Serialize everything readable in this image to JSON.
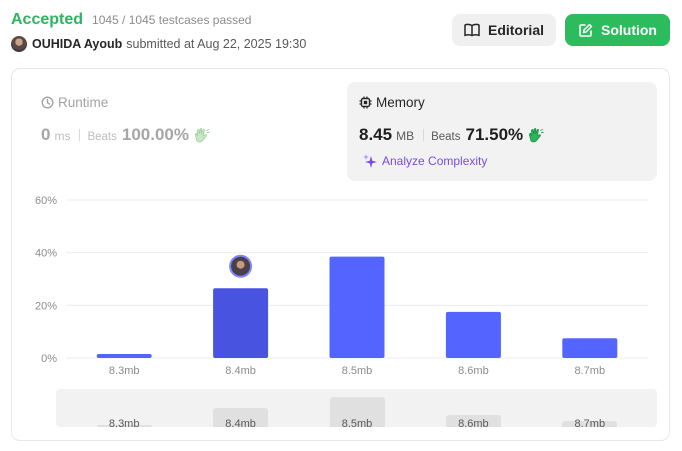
{
  "header": {
    "status": "Accepted",
    "testcases": "1045 / 1045 testcases passed",
    "user": "OUHIDA Ayoub",
    "submitted": "submitted at Aug 22, 2025 19:30",
    "editorial_label": "Editorial",
    "solution_label": "Solution"
  },
  "runtime": {
    "title": "Runtime",
    "value": "0",
    "unit": "ms",
    "beats_label": "Beats",
    "beats_pct": "100.00%"
  },
  "memory": {
    "title": "Memory",
    "value": "8.45",
    "unit": "MB",
    "beats_label": "Beats",
    "beats_pct": "71.50%",
    "analyze_label": "Analyze Complexity"
  },
  "colors": {
    "accepted": "#2db55d",
    "solution_btn": "#2cbb5d",
    "bar": "#5465ff",
    "bar_selected": "#4854e0",
    "analyze": "#7b4be0"
  },
  "icons": {
    "editorial": "book-icon",
    "solution": "edit-icon",
    "runtime": "clock-icon",
    "memory": "chip-icon",
    "beats": "clapping-hands-icon",
    "analyze": "sparkle-icon"
  },
  "chart_data": {
    "type": "bar",
    "categories": [
      "8.3mb",
      "8.4mb",
      "8.5mb",
      "8.6mb",
      "8.7mb"
    ],
    "values": [
      1.5,
      26.5,
      38.5,
      17.5,
      7.5
    ],
    "selected_index": 1,
    "ylim": [
      0,
      60
    ],
    "yticks": [
      "0%",
      "20%",
      "40%",
      "60%"
    ],
    "ytick_values": [
      0,
      20,
      40,
      60
    ],
    "grid": true,
    "navigator_values": [
      3,
      35,
      56,
      23,
      11
    ]
  }
}
